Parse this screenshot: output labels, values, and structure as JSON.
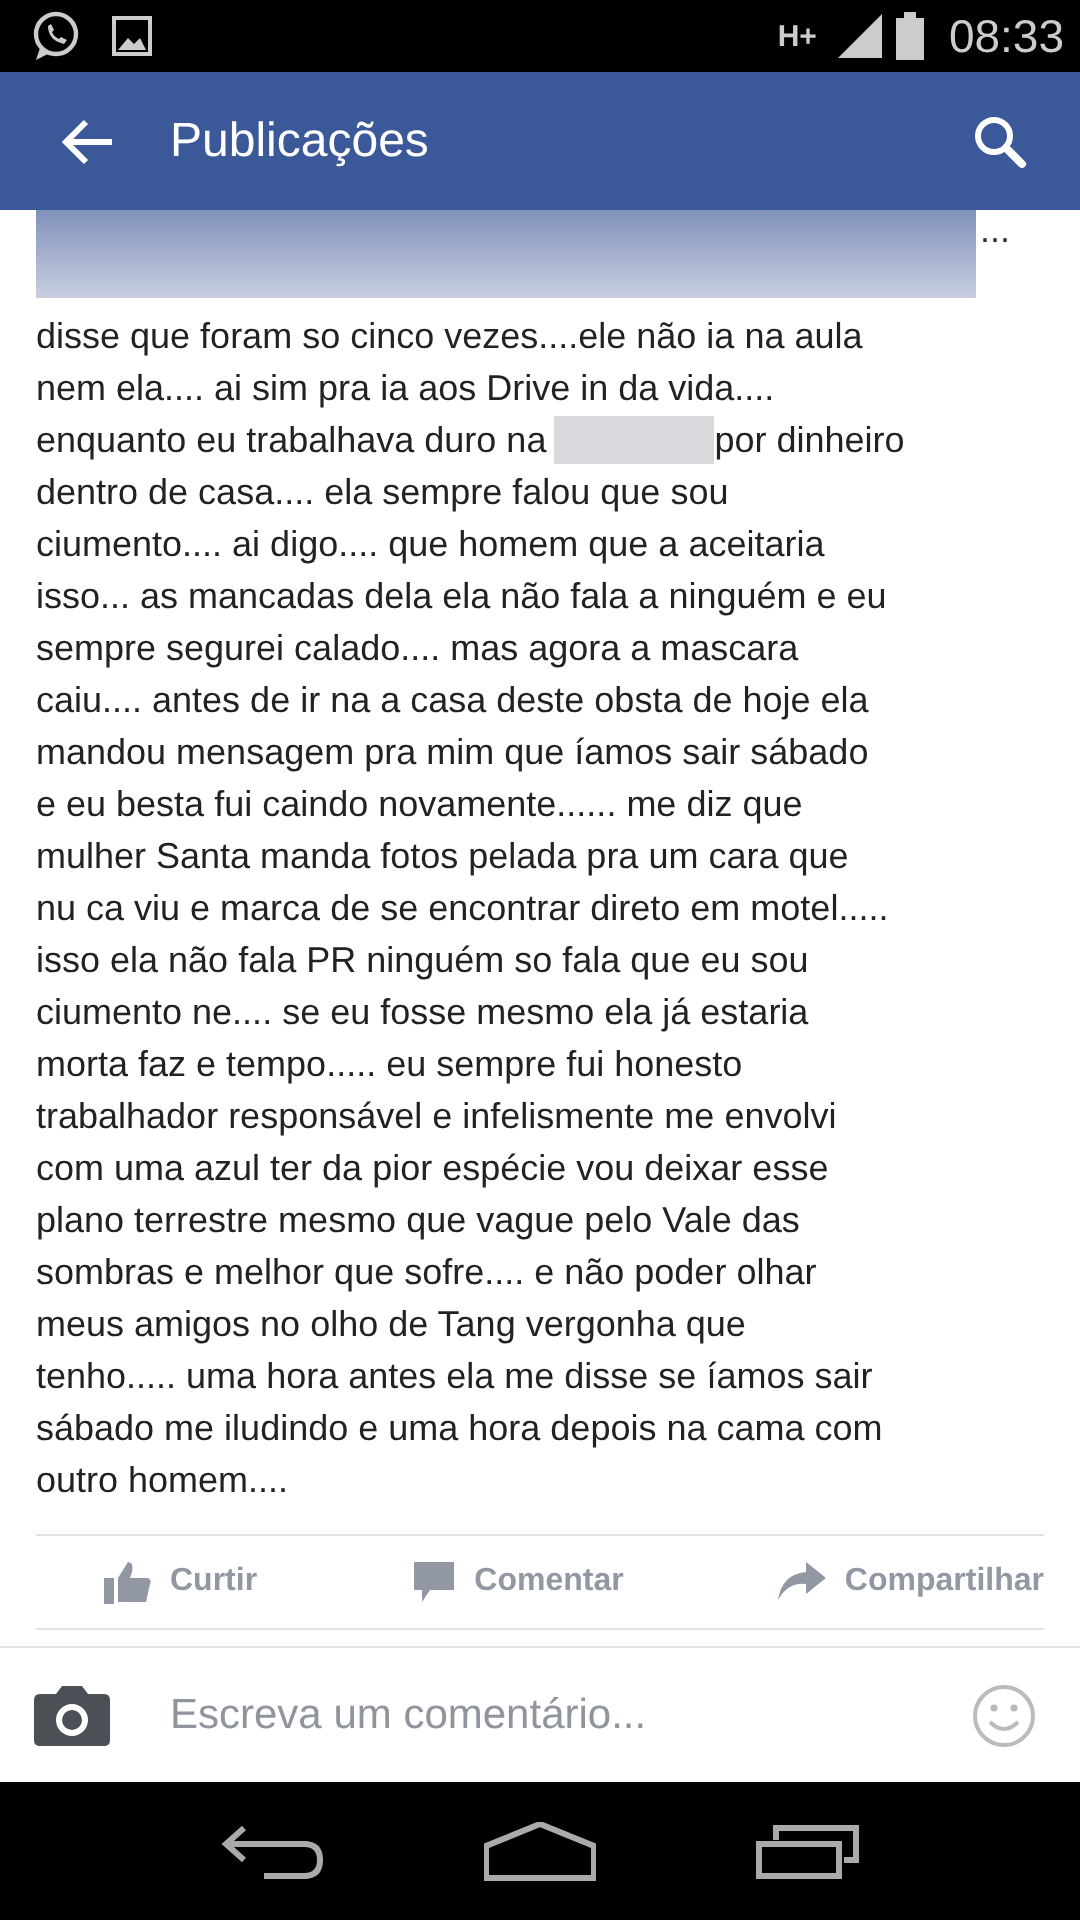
{
  "status_bar": {
    "network": "H+",
    "time": "08:33"
  },
  "app_bar": {
    "title": "Publicações"
  },
  "post": {
    "header_ellipsis": "...",
    "lines": [
      [
        "disse que foram so cinco vezes....ele não ia na aula"
      ],
      [
        "nem ela.... ai sim pra ia aos Drive in da vida...."
      ],
      [
        "enquanto eu trabalhava duro na",
        "por dinheiro"
      ],
      [
        "dentro de casa.... ela sempre falou que sou"
      ],
      [
        "ciumento.... ai digo.... que homem que a aceitaria"
      ],
      [
        "isso... as mancadas dela ela não fala a ninguém e eu"
      ],
      [
        "sempre segurei calado.... mas agora a mascara"
      ],
      [
        "caiu.... antes de ir na a casa deste obsta de hoje ela"
      ],
      [
        "mandou mensagem pra mim que íamos sair sábado"
      ],
      [
        "e eu besta fui caindo novamente...... me diz que"
      ],
      [
        "mulher Santa manda fotos pelada pra um cara que"
      ],
      [
        "nu ca viu e marca de se encontrar direto em motel....."
      ],
      [
        "isso ela não fala PR ninguém so fala que eu sou"
      ],
      [
        "ciumento ne.... se eu fosse mesmo ela já estaria"
      ],
      [
        "morta faz e tempo..... eu sempre fui honesto"
      ],
      [
        "trabalhador responsável e infelismente me envolvi"
      ],
      [
        "com uma azul ter da pior espécie vou deixar esse"
      ],
      [
        "plano terrestre mesmo que vague pelo Vale das"
      ],
      [
        "sombras e melhor que sofre.... e não poder olhar"
      ],
      [
        "meus amigos no olho de Tang vergonha que"
      ],
      [
        "tenho..... uma hora antes ela me disse se íamos sair"
      ],
      [
        "sábado me iludindo e uma hora depois na cama com"
      ],
      [
        "outro homem...."
      ]
    ],
    "actions": [
      {
        "kind": "like",
        "label": "Curtir"
      },
      {
        "kind": "comment",
        "label": "Comentar"
      },
      {
        "kind": "share",
        "label": "Compartilhar"
      }
    ]
  },
  "comment_bar": {
    "placeholder": "Escreva um comentário..."
  }
}
